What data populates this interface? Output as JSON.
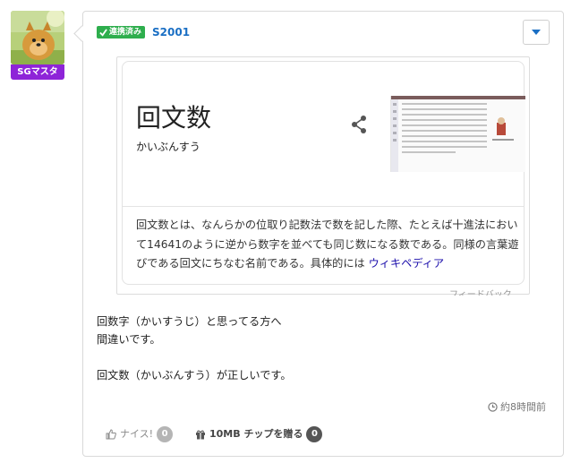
{
  "author": {
    "badge": "SGマスタ",
    "linked_label": "連携済み",
    "username": "S2001"
  },
  "embed": {
    "title": "回文数",
    "reading": "かいぶんすう",
    "description": "回文数とは、なんらかの位取り記数法で数を記した際、たとえば十進法において14641のように逆から数字を並べても同じ数になる数である。同様の言葉遊びである回文にちなむ名前である。具体的には",
    "source_link": "ウィキペディア",
    "feedback": "フィードバック",
    "share_icon": "share-icon"
  },
  "post": {
    "lines": [
      "回数字（かいすうじ）と思ってる方へ",
      "間違いです。",
      "",
      "回文数（かいぶんすう）が正しいです。"
    ],
    "timestamp": "約8時間前"
  },
  "footer": {
    "like_label": "ナイス!",
    "like_count": "0",
    "tip_label": "10MB チップを贈る",
    "tip_count": "0"
  },
  "colors": {
    "badge_purple": "#8e24d8",
    "linked_green": "#2eae4d",
    "username_blue": "#1a6fc4",
    "link_blue": "#1a0dab"
  }
}
